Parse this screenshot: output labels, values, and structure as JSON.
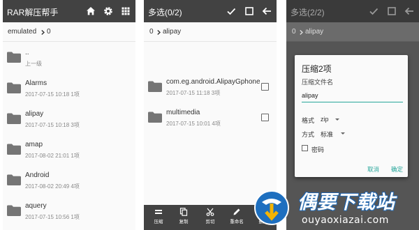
{
  "panel1": {
    "title": "RAR解压帮手",
    "breadcrumb": {
      "root": "emulated",
      "current": "0"
    },
    "rows": [
      {
        "name": "..",
        "meta": "上一级"
      },
      {
        "name": "Alarms",
        "meta": "2017-07-15 10:18  1项"
      },
      {
        "name": "alipay",
        "meta": "2017-07-15 10:18  3项"
      },
      {
        "name": "amap",
        "meta": "2017-08-02 21:01  1项"
      },
      {
        "name": "Android",
        "meta": "2017-08-02 20:49  4项"
      },
      {
        "name": "aquery",
        "meta": "2017-07-15 10:56  1项"
      }
    ]
  },
  "panel2": {
    "title": "多选(0/2)",
    "breadcrumb": {
      "root": "0",
      "current": "alipay"
    },
    "rows": [
      {
        "name": "com.eg.android.AlipayGphone",
        "meta": "2017-07-15 11:18  3项"
      },
      {
        "name": "multimedia",
        "meta": "2017-07-15 10:01  4项"
      }
    ],
    "bottombar": [
      "压缩",
      "复制",
      "剪切",
      "重命名",
      "删除"
    ]
  },
  "panel3": {
    "title": "多选(2/2)",
    "breadcrumb": {
      "root": "0",
      "current": "alipay"
    },
    "dialog": {
      "title": "压缩2项",
      "filename_label": "压缩文件名",
      "filename_value": "alipay",
      "format_label": "格式",
      "format_value": "zip",
      "method_label": "方式",
      "method_value": "标准",
      "password_label": "密码",
      "cancel": "取消",
      "confirm": "确定"
    }
  },
  "watermark": {
    "text": "偶要下载站",
    "url": "ouyaoxiazai.com"
  },
  "colors": {
    "appbar": "#424242",
    "accent": "#26a69a",
    "folder": "#757575"
  }
}
